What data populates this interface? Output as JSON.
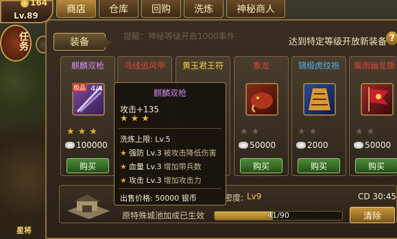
{
  "player": {
    "level": "Lv.89",
    "coins": "164"
  },
  "task_badge": "任务",
  "side_label": "星将",
  "tabs": [
    {
      "label": "商店",
      "active": true
    },
    {
      "label": "仓库",
      "active": false
    },
    {
      "label": "回购",
      "active": false
    },
    {
      "label": "洗炼",
      "active": false
    },
    {
      "label": "神秘商人",
      "active": false
    }
  ],
  "panel": {
    "equip_tab": "装备",
    "hint": "达到特定等级开放新装备",
    "help": "?",
    "bg_text": "提醒：神秘等级开启1000事件"
  },
  "items": [
    {
      "name": "麒麟双枪",
      "name_color": "#c98ae8",
      "stars": "★★★",
      "stars_lit": true,
      "price": "100000",
      "buy": "购买",
      "icon": "dual-spear-icon",
      "badge": "极品",
      "count": "4/4"
    },
    {
      "name": "乌线追风甲",
      "name_color": "#e0443a",
      "stars": "",
      "stars_lit": true,
      "price": "",
      "buy": "",
      "icon": "",
      "badge": "",
      "count": ""
    },
    {
      "name": "黄玉君王符",
      "name_color": "#f0d040",
      "stars": "",
      "stars_lit": true,
      "price": "",
      "buy": "",
      "icon": "",
      "badge": "",
      "count": ""
    },
    {
      "name": "象龙",
      "name_color": "#e0443a",
      "stars": "★★",
      "stars_lit": false,
      "price": "50000",
      "buy": "购买",
      "icon": "elephant-dragon-icon",
      "badge": "",
      "count": ""
    },
    {
      "name": "锦缎虎纹袍",
      "name_color": "#4ab0e8",
      "stars": "★★",
      "stars_lit": false,
      "price": "2000",
      "buy": "购买",
      "icon": "tiger-robe-icon",
      "badge": "",
      "count": ""
    },
    {
      "name": "乘雨幽龙旗",
      "name_color": "#e0443a",
      "stars": "★★",
      "stars_lit": false,
      "price": "50000",
      "buy": "购买",
      "icon": "dragon-flag-icon",
      "badge": "",
      "count": ""
    }
  ],
  "tooltip": {
    "title": "麒麟双枪",
    "attack": "攻击+135",
    "stars": "★★★",
    "wash_limit": "洗炼上限: Lv.5",
    "rows": [
      {
        "stat": "强防 Lv.3",
        "desc": "被攻击降低伤害"
      },
      {
        "stat": "血量 Lv.3",
        "desc": "增加带兵数"
      },
      {
        "stat": "攻击 Lv.3",
        "desc": "增加攻击力"
      }
    ],
    "sale_price": "出售价格: 50000 银币"
  },
  "bottom": {
    "progress_label": "密度:",
    "progress_level": "Lv9",
    "cd": "CD 30:45",
    "effect": "原特殊城池加成已生效",
    "progress_text": "41/90",
    "progress_fraction": 0.4556,
    "clear": "清除"
  },
  "colors": {
    "gold": "#e6b634",
    "panel_border": "#8d7040",
    "buy_green": "#4c8a3a"
  }
}
